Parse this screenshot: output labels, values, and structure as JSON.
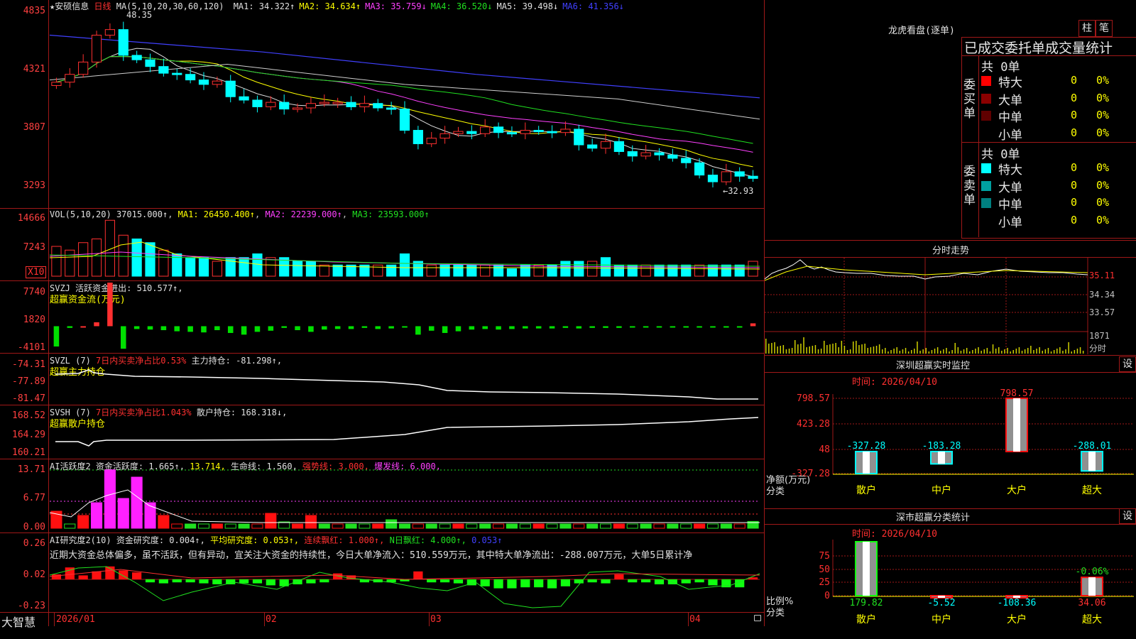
{
  "stock": {
    "star": "★",
    "name": "安硕信息",
    "period": "日线"
  },
  "price_panel": {
    "ma_label": "MA(5,10,20,30,60,120)",
    "ma_values": [
      {
        "label": "MA1:",
        "value": "34.322↑",
        "color": "#e0e0e0"
      },
      {
        "label": "MA2:",
        "value": "34.634↑",
        "color": "#ffff00"
      },
      {
        "label": "MA3:",
        "value": "35.759↓",
        "color": "#ff40ff"
      },
      {
        "label": "MA4:",
        "value": "36.520↓",
        "color": "#20e020"
      },
      {
        "label": "MA5:",
        "value": "39.498↓",
        "color": "#e0e0e0"
      },
      {
        "label": "MA6:",
        "value": "41.356↓",
        "color": "#4040ff"
      }
    ],
    "y_ticks": [
      "4835",
      "4321",
      "3807",
      "3293"
    ],
    "high_mark": "48.35",
    "low_mark": "←32.93"
  },
  "vol_panel": {
    "label": "VOL(5,10,20)",
    "value": "37015.000↑",
    "ma1": "MA1: 26450.400↑",
    "ma2": "MA2: 22239.000↑",
    "ma3": "MA3: 23593.000↑",
    "y_ticks": [
      "14666",
      "7243"
    ],
    "unit": "X10"
  },
  "svzj_panel": {
    "label": "SVZJ",
    "title": "活跃资金进出: 510.577↑,",
    "subtitle": "超赢资金流(万元)",
    "y_ticks": [
      "7740",
      "1820",
      "-4101"
    ]
  },
  "svzl_panel": {
    "label": "SVZL (7)",
    "ratio": "7日内买卖净占比0.53%",
    "main": "主力持仓: -81.298↑,",
    "subtitle": "超赢主力持仓",
    "y_ticks": [
      "-74.31",
      "-77.89",
      "-81.47"
    ]
  },
  "svsh_panel": {
    "label": "SVSH (7)",
    "ratio": "7日内买卖净占比1.043%",
    "retail": "散户持仓: 168.318↓,",
    "subtitle": "超赢散户持仓",
    "y_ticks": [
      "168.52",
      "164.29",
      "160.21"
    ]
  },
  "ai_active_panel": {
    "label": "AI活跃度2",
    "t1": "资金活跃度: 1.665↑,",
    "t2": "13.714,",
    "t3": "生命线: 1.560,",
    "t4": "强势线: 3.000,",
    "t5": "爆发线: 6.000,",
    "y_ticks": [
      "13.71",
      "6.77",
      "0.00"
    ]
  },
  "ai_research_panel": {
    "label": "AI研究度2(10)",
    "t1": "资金研究度: 0.004↑,",
    "t2": "平均研究度: 0.053↑,",
    "t3": "连续飘红: 1.000↑,",
    "t4": "N日飘红: 4.000↑,",
    "t5": "0.053↑",
    "comment": "近期大资金总体偏多，虽不活跃，但有异动，宜关注大资金的持续性，今日大单净流入：510.559万元，其中特大单净流出：-288.007万元，大单5日累计净",
    "y_ticks": [
      "0.26",
      "0.02",
      "-0.23"
    ]
  },
  "x_axis": {
    "brand": "大智慧",
    "labels": [
      "2026/01",
      "02",
      "03",
      "04"
    ]
  },
  "chart_data": [
    {
      "type": "candlestick",
      "title": "安硕信息 日线",
      "ylim": [
        32.93,
        48.35
      ],
      "x": [
        "2026/01",
        "02",
        "03",
        "04"
      ],
      "approx_closes": [
        42.8,
        43.5,
        44.6,
        47.0,
        47.5,
        45.2,
        44.8,
        44.2,
        43.6,
        43.5,
        43.0,
        42.6,
        42.9,
        41.5,
        41.2,
        40.6,
        41.0,
        40.4,
        40.5,
        40.9,
        41.0,
        41.0,
        40.6,
        40.9,
        40.5,
        40.4,
        38.5,
        37.3,
        37.8,
        38.2,
        38.4,
        38.2,
        38.8,
        38.3,
        38.2,
        38.5,
        38.4,
        38.3,
        38.6,
        37.2,
        36.9,
        37.5,
        36.6,
        36.2,
        36.5,
        36.3,
        36.0,
        35.6,
        34.5,
        33.9,
        34.8,
        34.4,
        34.2
      ]
    },
    {
      "type": "bar",
      "title": "SVZJ 活跃资金进出",
      "series_note": "red positive, green negative",
      "approx_values": [
        -3600,
        -300,
        0,
        700,
        7740,
        -4000,
        -500,
        -600,
        -700,
        -900,
        -1000,
        -1100,
        -700,
        -1200,
        -1500,
        -1000,
        -800,
        -300,
        -700,
        -1000,
        -600,
        -500,
        -500,
        -300,
        -500,
        -400,
        -200,
        -1500,
        -800,
        -1200,
        -900,
        -600,
        -500,
        -600,
        -500,
        -400,
        -400,
        -400,
        -300,
        -400,
        -300,
        -300,
        -300,
        -200,
        -200,
        -200,
        -200,
        -100,
        -100,
        -100,
        -100,
        -100,
        510
      ]
    },
    {
      "type": "bar",
      "title": "深圳超赢实时监控",
      "time": "时间: 2026/04/10",
      "categories": [
        "散户",
        "中户",
        "大户",
        "超大"
      ],
      "values": [
        -327.28,
        -183.28,
        798.57,
        -288.01
      ],
      "y_ticks": [
        "798.57",
        "423.28",
        "48",
        "-327.28"
      ],
      "ylabel": "净额(万元)",
      "xlabel": "分类"
    },
    {
      "type": "bar",
      "title": "深市超赢分类统计",
      "time": "时间: 2026/04/10",
      "categories": [
        "散户",
        "中户",
        "大户",
        "超大"
      ],
      "values": [
        179.82,
        -5.52,
        -108.36,
        34.06
      ],
      "extra_label": "-0.06%",
      "y_ticks": [
        "75",
        "50",
        "25",
        "0"
      ],
      "ylabel": "比例%",
      "xlabel": "分类"
    }
  ],
  "right_panel": {
    "longhu_title": "龙虎看盘(逐单)",
    "btn_zhu": "柱",
    "btn_bi": "笔",
    "stat_title": "已成交委托单成交量统计",
    "buy": {
      "side_label": "委买单",
      "total": "共 0单",
      "rows": [
        {
          "name": "特大",
          "count": "0",
          "pct": "0%",
          "color": "#ff0000"
        },
        {
          "name": "大单",
          "count": "0",
          "pct": "0%",
          "color": "#8b0000"
        },
        {
          "name": "中单",
          "count": "0",
          "pct": "0%",
          "color": "#600000"
        },
        {
          "name": "小单",
          "count": "0",
          "pct": "0%",
          "color": "#000000"
        }
      ]
    },
    "sell": {
      "side_label": "委卖单",
      "total": "共 0单",
      "rows": [
        {
          "name": "特大",
          "count": "0",
          "pct": "0%",
          "color": "#00ffff"
        },
        {
          "name": "大单",
          "count": "0",
          "pct": "0%",
          "color": "#00a0a0"
        },
        {
          "name": "中单",
          "count": "0",
          "pct": "0%",
          "color": "#008080"
        },
        {
          "name": "小单",
          "count": "0",
          "pct": "0%",
          "color": "#000000"
        }
      ]
    },
    "intraday_title": "分时走势",
    "intraday_ticks": [
      "35.11",
      "34.34",
      "33.57",
      "1871",
      "分时"
    ],
    "sz_monitor_title": "深圳超赢实时监控",
    "sz_stat_title": "深市超赢分类统计",
    "set_btn": "设",
    "time_label": "时间: 2026/04/10"
  }
}
